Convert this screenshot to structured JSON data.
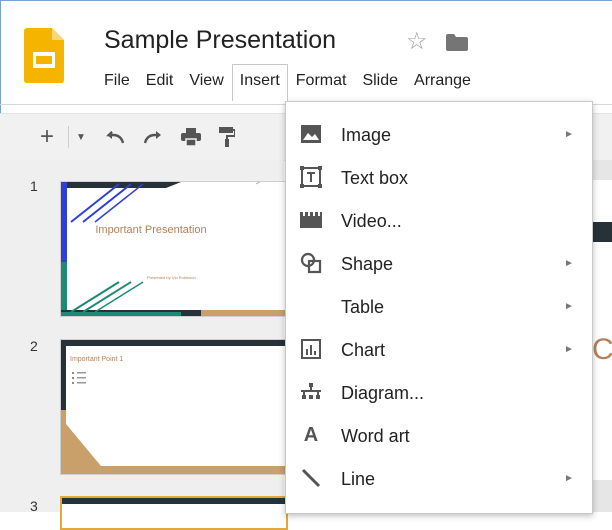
{
  "app": {
    "title": "Sample Presentation",
    "star_icon": "star-outline-icon",
    "folder_icon": "folder-icon"
  },
  "menubar": {
    "items": [
      "File",
      "Edit",
      "View",
      "Insert",
      "Format",
      "Slide",
      "Arrange"
    ],
    "active": "Insert"
  },
  "toolbar": {
    "icons": [
      "new-slide-plus-icon",
      "dropdown-icon",
      "undo-icon",
      "redo-icon",
      "print-icon",
      "paint-format-icon"
    ]
  },
  "slides": [
    {
      "number": "1",
      "title": "Important Presentation",
      "subtitle": "Presented by Ulo Robinson"
    },
    {
      "number": "2",
      "title": "Important Point 1"
    },
    {
      "number": "3"
    }
  ],
  "canvas": {
    "partial_letter": "C"
  },
  "insert_menu": {
    "items": [
      {
        "label": "Image",
        "icon": "image-icon",
        "submenu": true
      },
      {
        "label": "Text box",
        "icon": "text-box-icon",
        "submenu": false
      },
      {
        "label": "Video...",
        "icon": "video-icon",
        "submenu": false
      },
      {
        "label": "Shape",
        "icon": "shape-icon",
        "submenu": true
      },
      {
        "label": "Table",
        "icon": "",
        "submenu": true
      },
      {
        "label": "Chart",
        "icon": "chart-icon",
        "submenu": true
      },
      {
        "label": "Diagram...",
        "icon": "diagram-icon",
        "submenu": false
      },
      {
        "label": "Word art",
        "icon": "word-art-icon",
        "submenu": false
      },
      {
        "label": "Line",
        "icon": "line-icon",
        "submenu": true
      }
    ],
    "submenu_arrow": "►"
  },
  "colors": {
    "accent_yellow": "#f4b400",
    "slide_dark": "#263238",
    "slide_blue": "#2d3fd6",
    "slide_teal": "#1f8a73",
    "slide_tan": "#c9a06a"
  }
}
